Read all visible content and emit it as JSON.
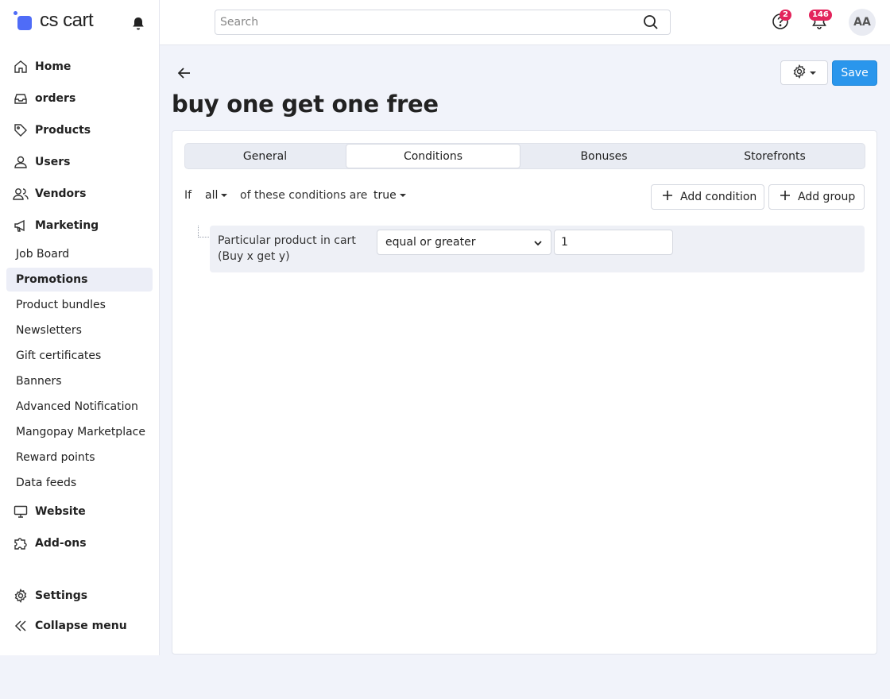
{
  "app": {
    "logo_text": "cs cart"
  },
  "sidebar": {
    "items": [
      {
        "label": "Home"
      },
      {
        "label": "orders"
      },
      {
        "label": "Products"
      },
      {
        "label": "Users"
      },
      {
        "label": "Vendors"
      },
      {
        "label": "Marketing"
      },
      {
        "label": "Job Board"
      },
      {
        "label": "Promotions"
      },
      {
        "label": "Product bundles"
      },
      {
        "label": "Newsletters"
      },
      {
        "label": "Gift certificates"
      },
      {
        "label": "Banners"
      },
      {
        "label": "Advanced Notification"
      },
      {
        "label": "Mangopay Marketplace"
      },
      {
        "label": "Reward points"
      },
      {
        "label": "Data feeds"
      },
      {
        "label": "Website"
      },
      {
        "label": "Add-ons"
      },
      {
        "label": "Settings"
      },
      {
        "label": "Collapse menu"
      }
    ],
    "active": "Promotions"
  },
  "header": {
    "search_placeholder": "Search",
    "help_badge": "2",
    "notifications_badge": "146",
    "avatar_initials": "AA"
  },
  "page": {
    "title": "buy one get one free",
    "save_label": "Save"
  },
  "tabs": [
    {
      "label": "General"
    },
    {
      "label": "Conditions"
    },
    {
      "label": "Bonuses"
    },
    {
      "label": "Storefronts"
    }
  ],
  "active_tab": "Conditions",
  "conditions": {
    "if_label": "If",
    "match_value": "all",
    "middle_text": "of these conditions are",
    "truth_value": "true",
    "add_condition_label": "Add condition",
    "add_group_label": "Add group",
    "rows": [
      {
        "label": "Particular product in cart (Buy x get y)",
        "operator": "equal or greater",
        "value": "1"
      }
    ]
  },
  "colors": {
    "accent": "#2a96ec",
    "logo": "#4f6cf7",
    "badge": "#e3245c",
    "background": "#f1f3fa"
  }
}
